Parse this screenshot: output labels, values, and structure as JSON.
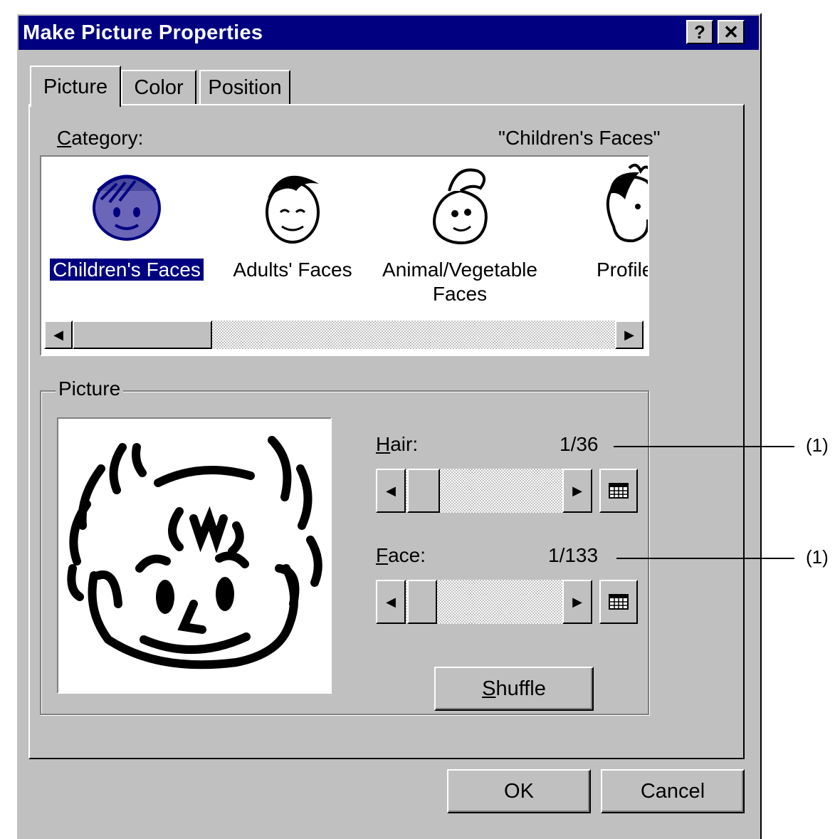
{
  "window": {
    "title": "Make Picture Properties",
    "help_label": "?",
    "close_label": "✕"
  },
  "tabs": [
    {
      "label": "Picture",
      "selected": true
    },
    {
      "label": "Color",
      "selected": false
    },
    {
      "label": "Position",
      "selected": false
    }
  ],
  "category": {
    "label_hotkey": "C",
    "label_rest": "ategory:",
    "current": "\"Children's Faces\"",
    "items": [
      {
        "label": "Children's Faces",
        "selected": true,
        "icon": "child-face-icon"
      },
      {
        "label": "Adults' Faces",
        "selected": false,
        "icon": "adult-face-icon"
      },
      {
        "label": "Animal/Vegetable Faces",
        "selected": false,
        "icon": "vegetable-face-icon"
      },
      {
        "label": "Profile",
        "selected": false,
        "icon": "profile-face-icon"
      }
    ]
  },
  "picture_group": {
    "title": "Picture",
    "hair": {
      "label_hotkey": "H",
      "label_rest": "air:",
      "value": "1/36"
    },
    "face": {
      "label_hotkey": "F",
      "label_rest": "ace:",
      "value": "1/133"
    },
    "shuffle": {
      "hotkey": "S",
      "rest": "huffle"
    }
  },
  "buttons": {
    "ok": "OK",
    "cancel": "Cancel"
  },
  "callouts": {
    "hair": "(1)",
    "face": "(1)"
  }
}
